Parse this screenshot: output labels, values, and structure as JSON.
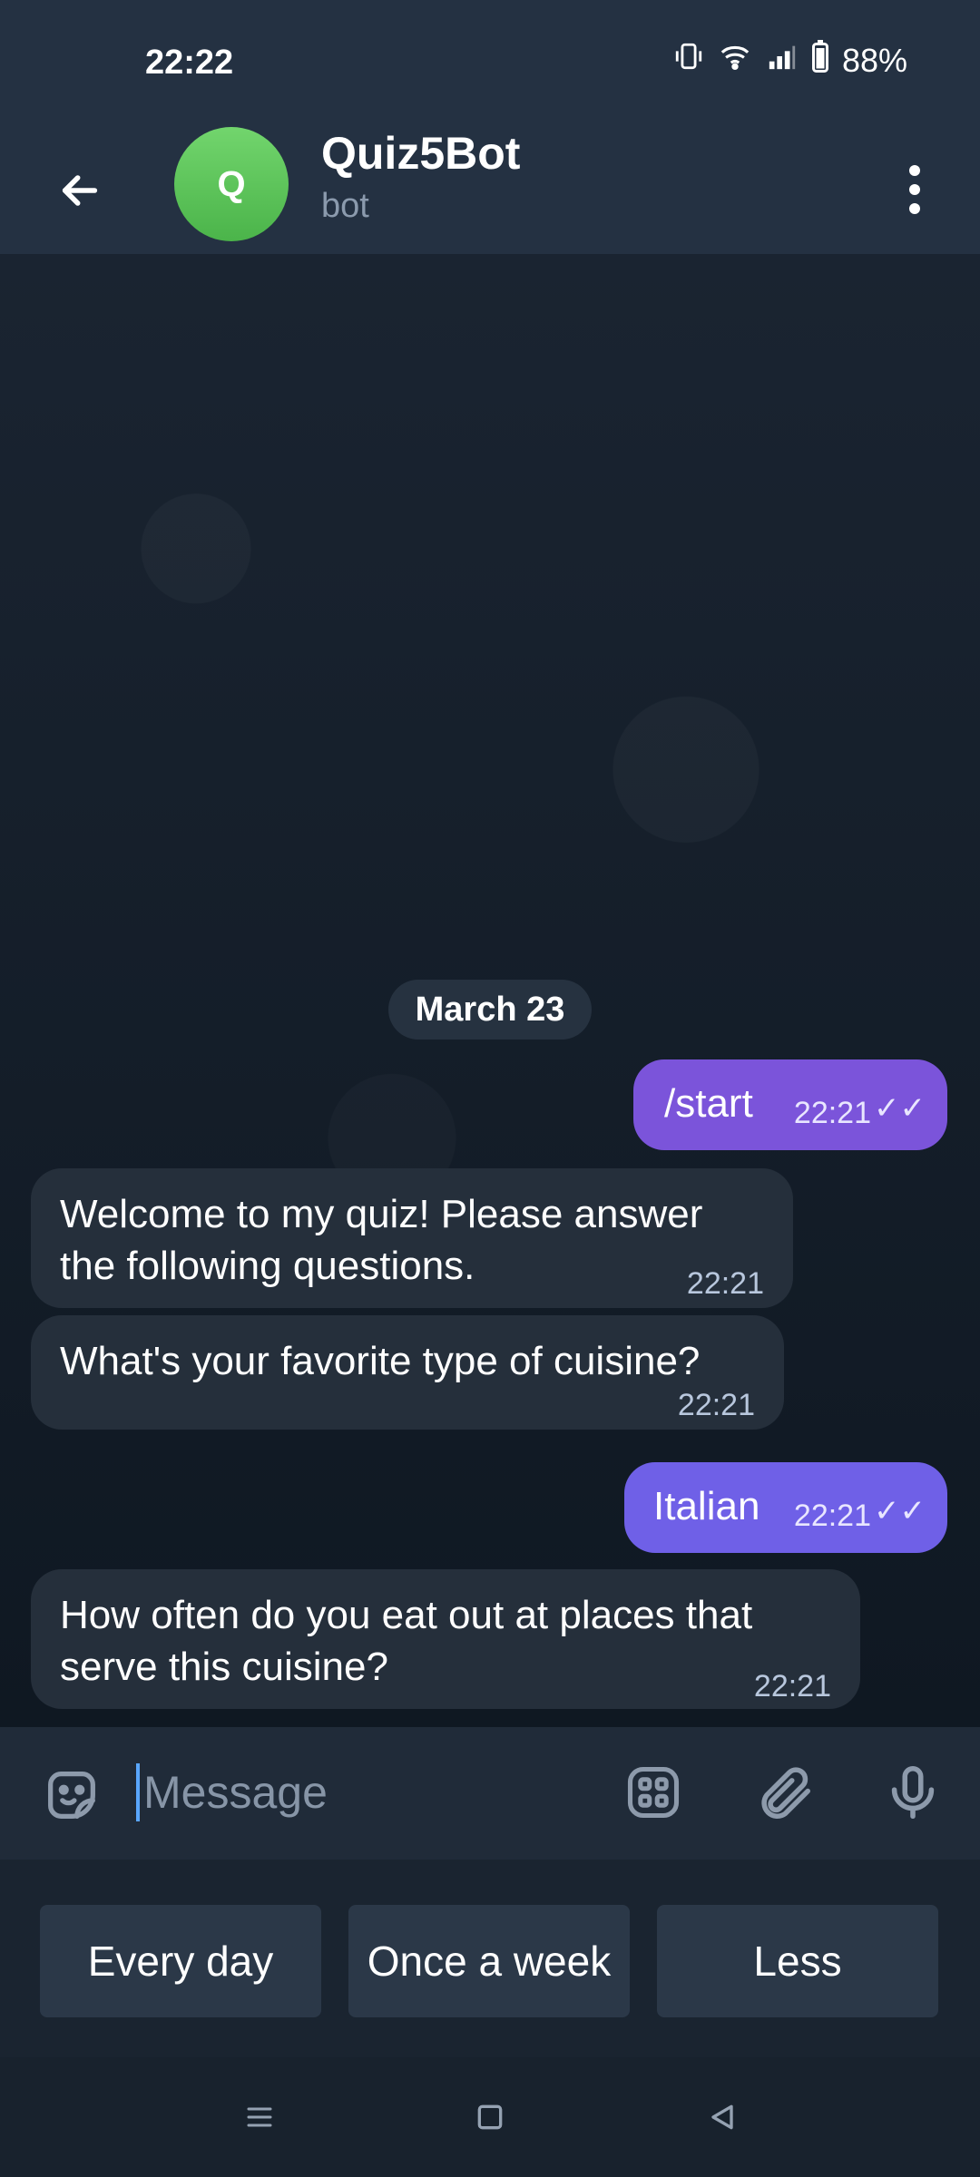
{
  "status_bar": {
    "time": "22:22",
    "battery": "88%"
  },
  "header": {
    "avatar_letter": "Q",
    "title": "Quiz5Bot",
    "subtitle": "bot"
  },
  "chat": {
    "date_label": "March 23",
    "messages": [
      {
        "text": "/start",
        "time": "22:21",
        "direction": "outgoing"
      },
      {
        "text": "Welcome to my quiz! Please answer the following questions.",
        "time": "22:21",
        "direction": "incoming"
      },
      {
        "text": "What's your favorite type of cuisine?",
        "time": "22:21",
        "direction": "incoming"
      },
      {
        "text": "Italian",
        "time": "22:21",
        "direction": "outgoing"
      },
      {
        "text": "How often do you eat out at places that serve this cuisine?",
        "time": "22:21",
        "direction": "incoming"
      }
    ]
  },
  "composer": {
    "placeholder": "Message"
  },
  "keyboard": {
    "buttons": [
      "Every day",
      "Once a week",
      "Less"
    ]
  },
  "icons": {
    "back": "arrow-left-icon",
    "menu": "more-vertical-icon",
    "emoji": "sticker-smile-icon",
    "apps": "apps-grid-icon",
    "attach": "paperclip-icon",
    "mic": "microphone-icon"
  },
  "colors": {
    "outgoing_bubble": "#7b54da",
    "incoming_bubble": "#252f3b",
    "avatar": "#5dc35a"
  }
}
